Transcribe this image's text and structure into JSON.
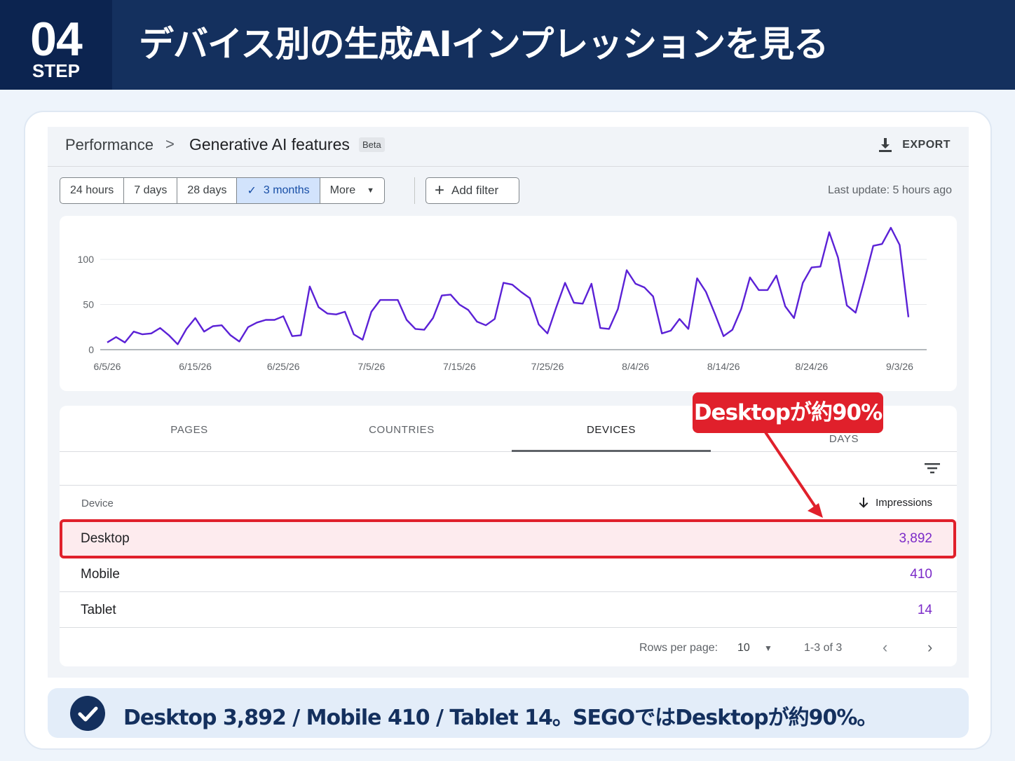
{
  "banner": {
    "step_number": "04",
    "step_label": "STEP",
    "title": "デバイス別の生成AIインプレッションを見る"
  },
  "breadcrumb": {
    "root": "Performance",
    "separator": ">",
    "current": "Generative AI features",
    "badge": "Beta"
  },
  "export_label": "EXPORT",
  "date_filters": [
    {
      "label": "24 hours",
      "active": false
    },
    {
      "label": "7 days",
      "active": false
    },
    {
      "label": "28 days",
      "active": false
    },
    {
      "label": "3 months",
      "active": true
    },
    {
      "label": "More",
      "active": false
    }
  ],
  "add_filter_label": "Add filter",
  "last_update": "Last update: 5 hours ago",
  "chart_data": {
    "type": "line",
    "title": "",
    "xlabel": "",
    "ylabel": "",
    "ylim": [
      0,
      135
    ],
    "yticks": [
      "0",
      "50",
      "100"
    ],
    "ytick_values": [
      0,
      50,
      100
    ],
    "xtick_labels": [
      "6/5/26",
      "6/15/26",
      "6/25/26",
      "7/5/26",
      "7/15/26",
      "7/25/26",
      "8/4/26",
      "8/14/26",
      "8/24/26",
      "9/3/26"
    ],
    "xtick_index": [
      0,
      10,
      20,
      30,
      40,
      50,
      60,
      70,
      80,
      90
    ],
    "grid": true,
    "color": "#5b21d6",
    "values": [
      8,
      14,
      8,
      20,
      17,
      18,
      24,
      16,
      6,
      23,
      35,
      20,
      26,
      27,
      16,
      9,
      25,
      30,
      33,
      33,
      37,
      15,
      16,
      70,
      47,
      40,
      39,
      42,
      17,
      11,
      42,
      55,
      55,
      55,
      33,
      23,
      22,
      35,
      60,
      61,
      50,
      44,
      31,
      27,
      34,
      74,
      72,
      64,
      57,
      28,
      18,
      47,
      74,
      52,
      51,
      73,
      24,
      23,
      45,
      88,
      73,
      69,
      59,
      18,
      21,
      34,
      23,
      79,
      64,
      40,
      15,
      22,
      45,
      80,
      66,
      66,
      82,
      48,
      35,
      74,
      91,
      92,
      130,
      102,
      49,
      41,
      77,
      115,
      117,
      135,
      116,
      36
    ]
  },
  "tabs": [
    {
      "label": "PAGES",
      "active": false
    },
    {
      "label": "COUNTRIES",
      "active": false
    },
    {
      "label": "DEVICES",
      "active": true
    },
    {
      "label": "DAYS",
      "active": false
    }
  ],
  "table": {
    "col_device": "Device",
    "col_impressions": "Impressions",
    "rows": [
      {
        "device": "Desktop",
        "impressions": "3,892"
      },
      {
        "device": "Mobile",
        "impressions": "410"
      },
      {
        "device": "Tablet",
        "impressions": "14"
      }
    ]
  },
  "pager": {
    "rows_per_page_label": "Rows per page:",
    "rows_per_page": "10",
    "range": "1-3 of 3"
  },
  "callout": "Desktopが約90%",
  "summary": "Desktop 3,892 / Mobile 410 / Tablet 14。SEGOではDesktopが約90%。",
  "colors": {
    "banner": "#14305e",
    "accent_red": "#e0202b",
    "line": "#5b21d6",
    "value_purple": "#7b2ac8"
  }
}
